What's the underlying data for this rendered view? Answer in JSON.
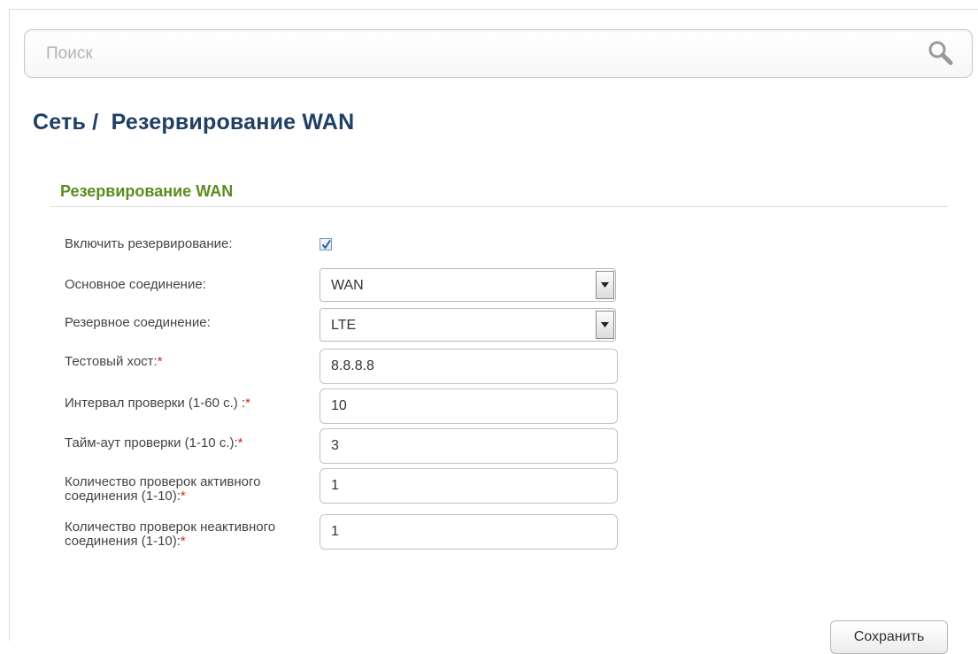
{
  "search": {
    "placeholder": "Поиск",
    "icon": "search-icon"
  },
  "page": {
    "title": "Сеть /  Резервирование WAN"
  },
  "section": {
    "title": "Резервирование WAN"
  },
  "form": {
    "enable": {
      "label": "Включить резервирование:",
      "checked": true
    },
    "primary": {
      "label": "Основное соединение:",
      "value": "WAN"
    },
    "backup": {
      "label": "Резервное соединение:",
      "value": "LTE"
    },
    "test_host": {
      "label": "Тестовый хост:",
      "required": "*",
      "value": "8.8.8.8"
    },
    "interval": {
      "label": "Интервал проверки (1-60 с.) :",
      "required": "*",
      "value": "10"
    },
    "timeout": {
      "label": "Тайм-аут проверки (1-10 с.):",
      "required": "*",
      "value": "3"
    },
    "active_checks": {
      "label": "Количество проверок активного соединения (1-10):",
      "required": "*",
      "value": "1"
    },
    "inactive_checks": {
      "label": "Количество проверок неактивного соединения (1-10):",
      "required": "*",
      "value": "1"
    }
  },
  "actions": {
    "save_label": "Сохранить"
  },
  "colors": {
    "title": "#1f3f63",
    "section_title": "#5c8d1e",
    "required": "#d9251c"
  }
}
